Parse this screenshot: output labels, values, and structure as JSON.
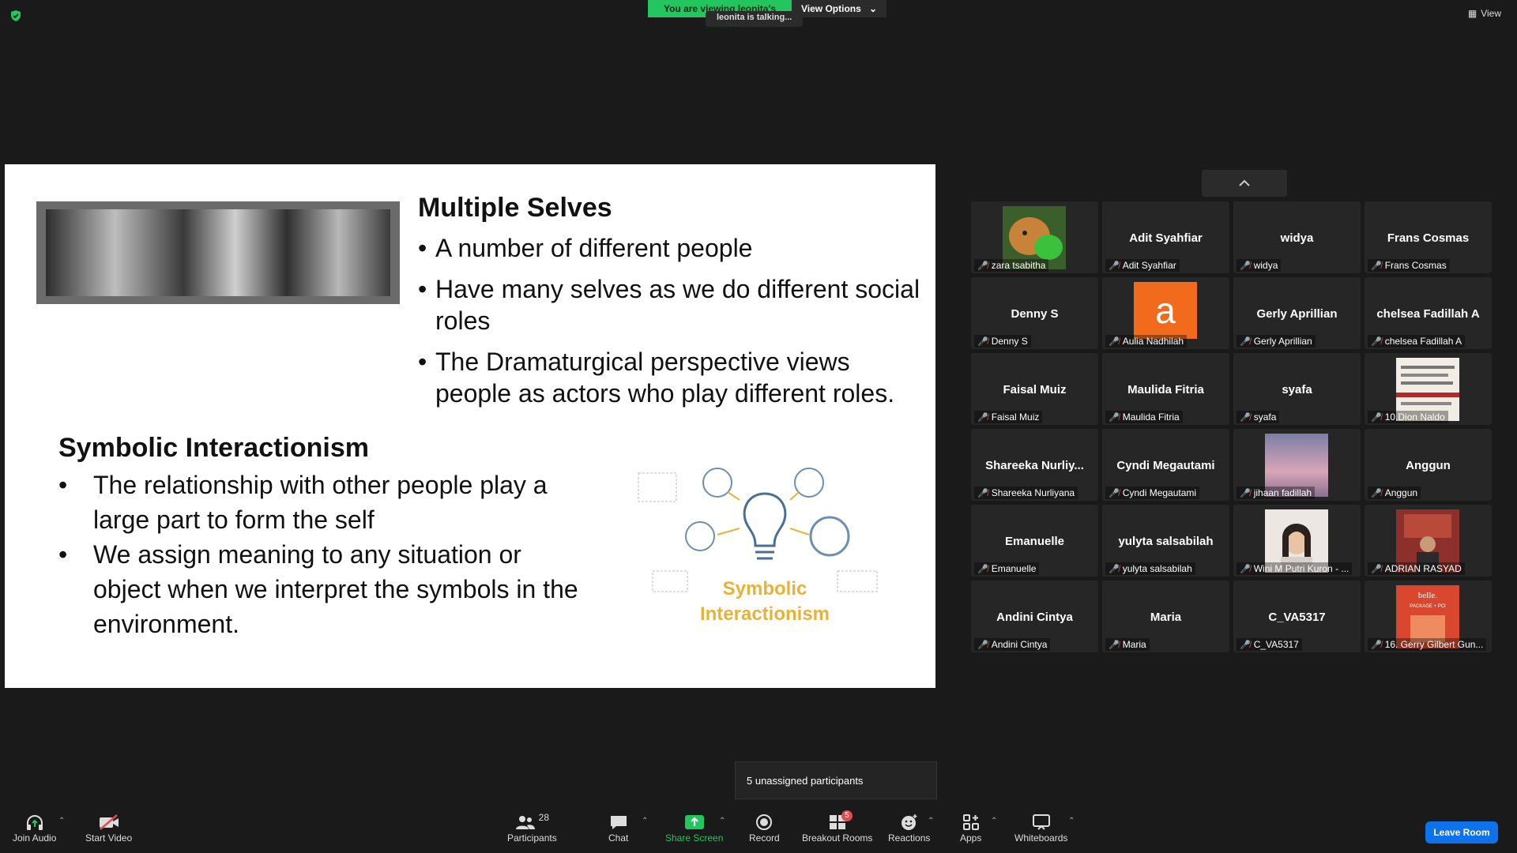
{
  "top": {
    "viewing_text": "You are viewing leonita's screen",
    "view_options": "View Options",
    "talking": "leonita is talking...",
    "view_label": "View"
  },
  "slide": {
    "ms_title": "Multiple Selves",
    "ms_items": [
      "A number of different people",
      "Have many selves as we do different social roles",
      "The Dramaturgical perspective views people as actors who play different roles."
    ],
    "si_title": "Symbolic Interactionism",
    "si_items": [
      "The relationship with other people play a large part to form the self",
      "We assign meaning to any situation or object when we interpret the symbols in the environment."
    ],
    "graphic_line1": "Symbolic",
    "graphic_line2": "Interactionism"
  },
  "participants": [
    {
      "name": "",
      "label": "zara tsabitha",
      "video": "cat"
    },
    {
      "name": "Adit Syahfiar",
      "label": "Adit Syahfiar"
    },
    {
      "name": "widya",
      "label": "widya"
    },
    {
      "name": "Frans Cosmas",
      "label": "Frans Cosmas"
    },
    {
      "name": "Denny S",
      "label": "Denny S"
    },
    {
      "name": "",
      "label": "Aulia Nadhilah",
      "avatar": "a"
    },
    {
      "name": "Gerly Aprillian",
      "label": "Gerly Aprillian"
    },
    {
      "name": "chelsea Fadillah A",
      "label": "chelsea Fadillah A"
    },
    {
      "name": "Faisal Muiz",
      "label": "Faisal Muiz"
    },
    {
      "name": "Maulida Fitria",
      "label": "Maulida Fitria"
    },
    {
      "name": "syafa",
      "label": "syafa"
    },
    {
      "name": "",
      "label": "10.Dion Naldo",
      "video": "text"
    },
    {
      "name": "Shareeka  Nurliy...",
      "label": "Shareeka Nurliyana"
    },
    {
      "name": "Cyndi Megautami",
      "label": "Cyndi Megautami"
    },
    {
      "name": "",
      "label": "jihaan fadillah",
      "video": "sky"
    },
    {
      "name": "Anggun",
      "label": "Anggun"
    },
    {
      "name": "Emanuelle",
      "label": "Emanuelle"
    },
    {
      "name": "yulyta salsabilah",
      "label": "yulyta salsabilah"
    },
    {
      "name": "",
      "label": "Wini M Putri Kuron - ...",
      "video": "face"
    },
    {
      "name": "",
      "label": "ADRIAN RASYAD",
      "video": "room"
    },
    {
      "name": "Andini Cintya",
      "label": "Andini Cintya"
    },
    {
      "name": "Maria",
      "label": "Maria"
    },
    {
      "name": "C_VA5317",
      "label": "C_VA5317"
    },
    {
      "name": "",
      "label": "16. Gerry Gilbert Gun...",
      "video": "book"
    }
  ],
  "book_text": "belle.",
  "book_subtext": "PACKAGE + PCI",
  "unassigned": "5 unassigned participants",
  "toolbar": {
    "join_audio": "Join Audio",
    "start_video": "Start Video",
    "participants": "Participants",
    "participants_count": "28",
    "chat": "Chat",
    "share_screen": "Share Screen",
    "record": "Record",
    "breakout_rooms": "Breakout Rooms",
    "breakout_badge": "5",
    "reactions": "Reactions",
    "apps": "Apps",
    "whiteboards": "Whiteboards",
    "leave_room": "Leave Room"
  },
  "colors": {
    "share_green": "#23c55e",
    "leave_blue": "#0e72ed",
    "mute_red": "#e5484d"
  }
}
